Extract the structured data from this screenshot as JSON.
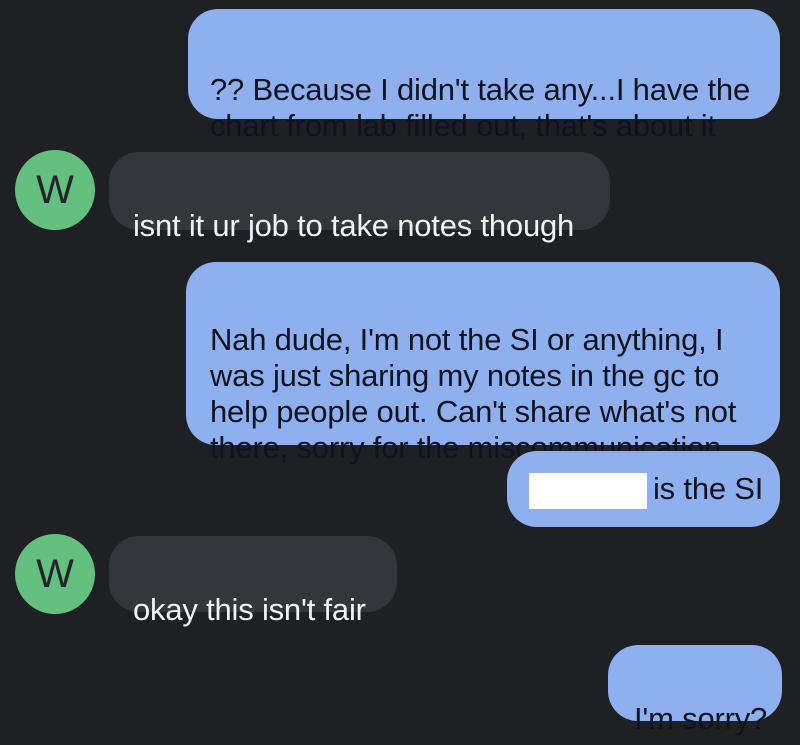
{
  "colors": {
    "background": "#1f2024",
    "sent_bubble": "#8fb0ef",
    "received_bubble": "#35363b",
    "avatar": "#63c07e"
  },
  "messages": [
    {
      "direction": "sent",
      "text": "?? Because I didn't take any...I have the\nchart from lab filled out, that's about it"
    },
    {
      "direction": "received",
      "avatar_letter": "W",
      "text": "isnt it ur job to take notes though"
    },
    {
      "direction": "sent",
      "text": "Nah dude, I'm not the SI or anything, I\nwas just sharing my notes in the gc to\nhelp people out. Can't share what's not\nthere, sorry for the miscommunication"
    },
    {
      "direction": "sent",
      "redacted": true,
      "text": "is the SI"
    },
    {
      "direction": "received",
      "avatar_letter": "W",
      "text": "okay this isn't fair"
    },
    {
      "direction": "sent",
      "text": "I'm sorry?"
    }
  ]
}
